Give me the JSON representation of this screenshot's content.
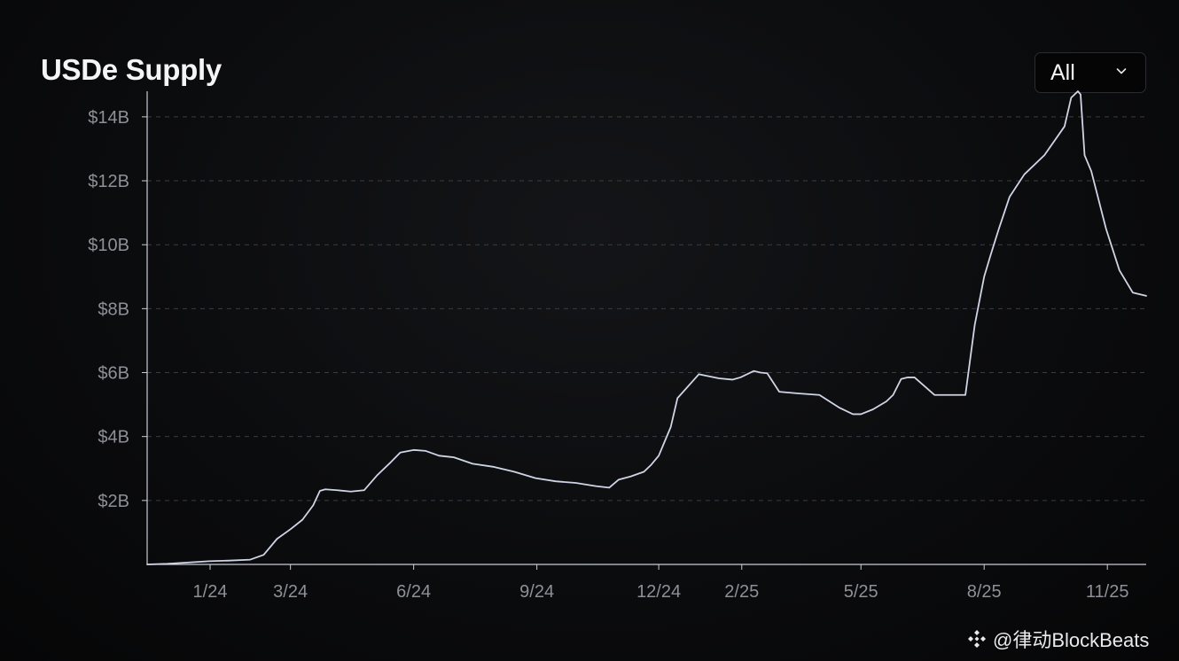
{
  "header": {
    "title": "USDe Supply",
    "range_value": "All"
  },
  "watermark": {
    "text": "@律动BlockBeats",
    "logo_icon": "binance-diamond-icon"
  },
  "colors": {
    "line": "#cfd5e6",
    "grid": "#3a3c42",
    "axis": "#c9ccd6",
    "tick_text": "#8e9098"
  },
  "chart_data": {
    "type": "line",
    "title": "USDe Supply",
    "xlabel": "",
    "ylabel": "",
    "grid": true,
    "x_ticks": [
      "1/24",
      "3/24",
      "6/24",
      "9/24",
      "12/24",
      "2/25",
      "5/25",
      "8/25",
      "11/25"
    ],
    "x_tick_dates": [
      "2024-01-01",
      "2024-03-01",
      "2024-06-01",
      "2024-09-01",
      "2024-12-01",
      "2025-02-01",
      "2025-05-01",
      "2025-08-01",
      "2025-11-01"
    ],
    "y_ticks": [
      "$2B",
      "$4B",
      "$6B",
      "$8B",
      "$10B",
      "$12B",
      "$14B"
    ],
    "y_tick_values": [
      2,
      4,
      6,
      8,
      10,
      12,
      14
    ],
    "xlim": [
      "2023-11-15",
      "2025-11-30"
    ],
    "ylim": [
      0,
      14.8
    ],
    "y_unit": "billion USD",
    "series": [
      {
        "x": [
          "2023-11-15",
          "2023-11-30",
          "2023-12-15",
          "2023-12-31",
          "2024-01-15",
          "2024-01-31",
          "2024-02-10",
          "2024-02-20",
          "2024-03-01",
          "2024-03-10",
          "2024-03-18",
          "2024-03-23",
          "2024-03-27",
          "2024-04-05",
          "2024-04-15",
          "2024-04-25",
          "2024-05-05",
          "2024-05-15",
          "2024-05-22",
          "2024-06-01",
          "2024-06-10",
          "2024-06-20",
          "2024-07-01",
          "2024-07-15",
          "2024-07-31",
          "2024-08-15",
          "2024-08-31",
          "2024-09-15",
          "2024-09-30",
          "2024-10-15",
          "2024-10-25",
          "2024-11-01",
          "2024-11-10",
          "2024-11-20",
          "2024-11-25",
          "2024-12-01",
          "2024-12-05",
          "2024-12-10",
          "2024-12-15",
          "2024-12-31",
          "2025-01-15",
          "2025-01-25",
          "2025-01-31",
          "2025-02-10",
          "2025-02-15",
          "2025-02-20",
          "2025-03-01",
          "2025-03-15",
          "2025-03-31",
          "2025-04-15",
          "2025-04-25",
          "2025-05-01",
          "2025-05-10",
          "2025-05-20",
          "2025-05-25",
          "2025-05-31",
          "2025-06-05",
          "2025-06-10",
          "2025-06-25",
          "2025-07-10",
          "2025-07-18",
          "2025-07-25",
          "2025-08-01",
          "2025-08-06",
          "2025-08-12",
          "2025-08-20",
          "2025-08-31",
          "2025-09-15",
          "2025-09-30",
          "2025-10-05",
          "2025-10-10",
          "2025-10-12",
          "2025-10-15",
          "2025-10-20",
          "2025-10-31",
          "2025-11-10",
          "2025-11-20",
          "2025-11-30"
        ],
        "values": [
          0.0,
          0.02,
          0.06,
          0.1,
          0.12,
          0.15,
          0.3,
          0.8,
          1.1,
          1.4,
          1.85,
          2.3,
          2.35,
          2.32,
          2.28,
          2.32,
          2.8,
          3.2,
          3.5,
          3.58,
          3.55,
          3.4,
          3.35,
          3.15,
          3.05,
          2.9,
          2.7,
          2.6,
          2.55,
          2.45,
          2.4,
          2.65,
          2.75,
          2.9,
          3.1,
          3.4,
          3.8,
          4.3,
          5.2,
          5.95,
          5.82,
          5.78,
          5.85,
          6.05,
          6.0,
          5.98,
          5.4,
          5.35,
          5.3,
          4.9,
          4.7,
          4.7,
          4.85,
          5.1,
          5.3,
          5.8,
          5.85,
          5.85,
          5.3,
          5.3,
          5.3,
          7.5,
          9.0,
          9.7,
          10.5,
          11.5,
          12.2,
          12.8,
          13.7,
          14.6,
          14.8,
          14.7,
          12.8,
          12.3,
          10.5,
          9.2,
          8.5,
          8.4
        ]
      }
    ]
  }
}
